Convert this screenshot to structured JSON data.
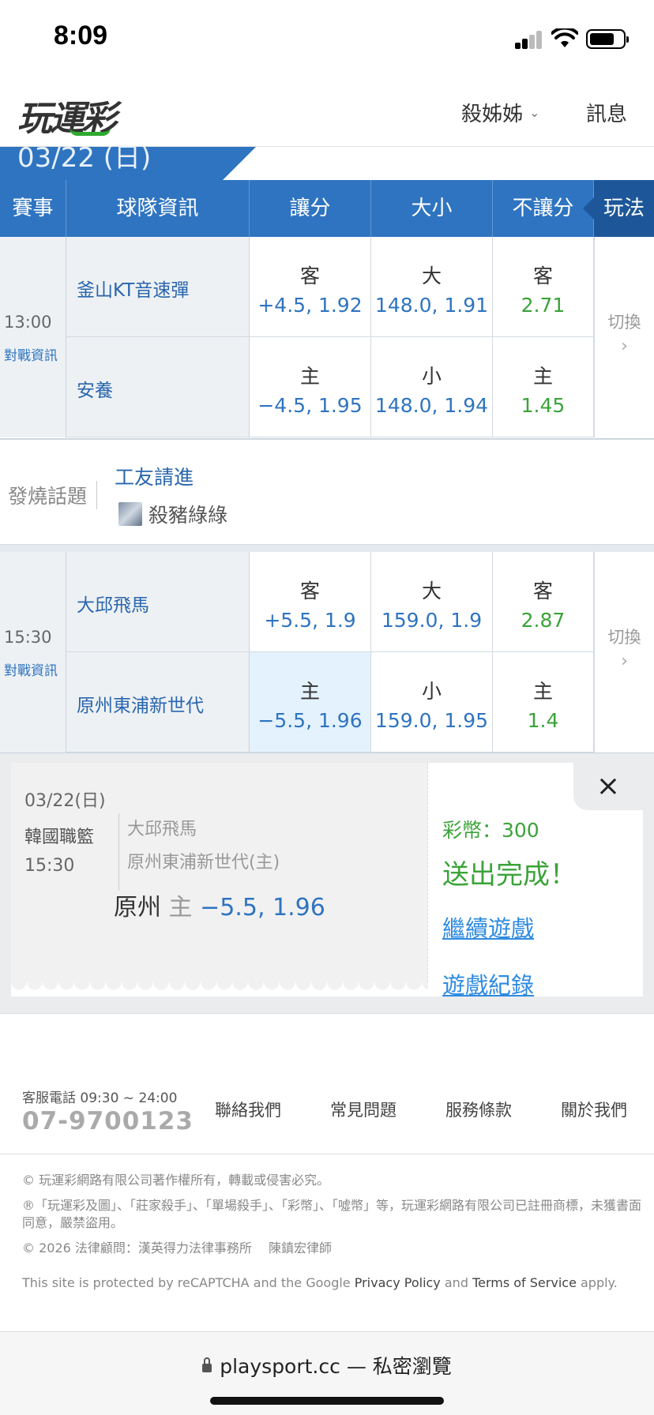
{
  "status_bar": {
    "time": "8:09"
  },
  "header": {
    "logo": "玩運彩",
    "user_menu": "殺姊姊",
    "message": "訊息"
  },
  "date_tab": "03/22 (日)",
  "columns": [
    "賽事",
    "球隊資訊",
    "讓分",
    "大小",
    "不讓分",
    "玩法"
  ],
  "games": [
    {
      "time": "13:00",
      "info_link": "對戰資訊",
      "switch": "切換",
      "rows": [
        {
          "team": "釜山KT音速彈",
          "spread_label": "客",
          "spread": "+4.5, 1.92",
          "total_label": "大",
          "total": "148.0, 1.91",
          "ml_label": "客",
          "ml": "2.71"
        },
        {
          "team": "安養",
          "spread_label": "主",
          "spread": "−4.5, 1.95",
          "total_label": "小",
          "total": "148.0, 1.94",
          "ml_label": "主",
          "ml": "1.45"
        }
      ]
    },
    {
      "time": "15:30",
      "info_link": "對戰資訊",
      "switch": "切換",
      "rows": [
        {
          "team": "大邱飛馬",
          "spread_label": "客",
          "spread": "+5.5, 1.9",
          "total_label": "大",
          "total": "159.0, 1.9",
          "ml_label": "客",
          "ml": "2.87"
        },
        {
          "team": "原州東浦新世代",
          "spread_label": "主",
          "spread": "−5.5, 1.96",
          "total_label": "小",
          "total": "159.0, 1.95",
          "ml_label": "主",
          "ml": "1.4"
        }
      ]
    }
  ],
  "hot_topic": {
    "label": "發燒話題",
    "title": "工友請進",
    "user": "殺豬綠綠"
  },
  "bet_slip": {
    "date": "03/22(日)",
    "league": "韓國職籃",
    "time": "15:30",
    "away_team": "大邱飛馬",
    "home_team": "原州東浦新世代(主)",
    "pick_team": "原州",
    "pick_side": "主",
    "pick_value": "−5.5, 1.96",
    "close": "×",
    "coins": "彩幣：300",
    "done": "送出完成！",
    "continue": "繼續遊戲",
    "history": "遊戲紀錄"
  },
  "footer": {
    "service_label": "客服電話 09:30 ~ 24:00",
    "phone": "07-9700123",
    "links": [
      "聯絡我們",
      "常見問題",
      "服務條款",
      "關於我們"
    ],
    "copyright": "© 玩運彩網路有限公司著作權所有，轉載或侵害必究。",
    "trademark": "®「玩運彩及圖」、「莊家殺手」、「單場殺手」、「彩幣」、「噓幣」等，玩運彩網路有限公司已註冊商標，未獲書面同意，嚴禁盜用。",
    "legal": "© 2026 法律顧問：漢英得力法律事務所 　陳鎮宏律師",
    "recaptcha_pre": "This site is protected by reCAPTCHA and the Google ",
    "privacy": "Privacy Policy",
    "and": " and ",
    "terms": "Terms of Service",
    "apply": " apply."
  },
  "browser": {
    "url": "playsport.cc — 私密瀏覽"
  },
  "colors": {
    "primary_blue": "#2f74c0",
    "dark_blue": "#1e5799",
    "odds_green": "#3ba339",
    "selected_bg": "#e4f2fd"
  }
}
